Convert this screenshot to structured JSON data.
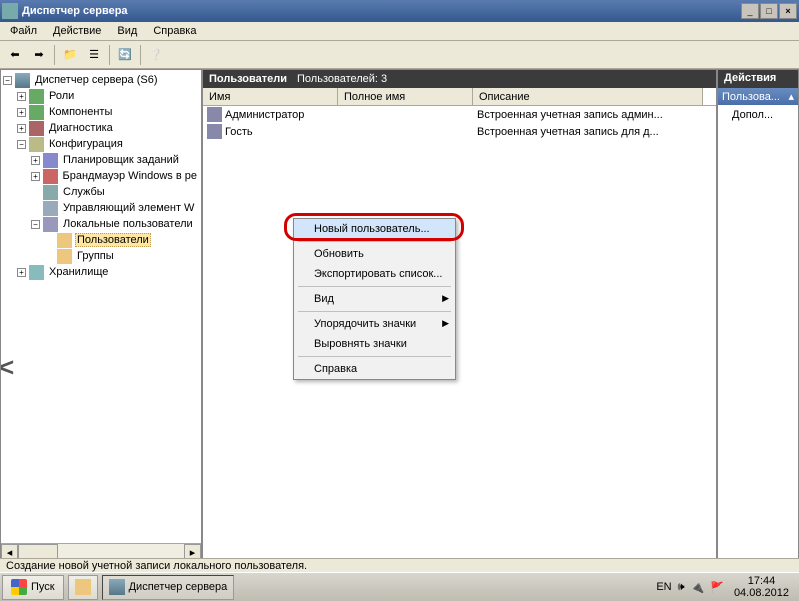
{
  "window": {
    "title": "Диспетчер сервера",
    "btn_min": "_",
    "btn_max": "□",
    "btn_close": "×"
  },
  "menu": {
    "file": "Файл",
    "action": "Действие",
    "view": "Вид",
    "help": "Справка"
  },
  "tree": {
    "root": "Диспетчер сервера (S6)",
    "roles": "Роли",
    "components": "Компоненты",
    "diagnostics": "Диагностика",
    "configuration": "Конфигурация",
    "taskscheduler": "Планировщик заданий",
    "firewall": "Брандмауэр Windows в ре",
    "services": "Службы",
    "wmi": "Управляющий элемент W",
    "localusers": "Локальные пользователи",
    "users": "Пользователи",
    "groups": "Группы",
    "storage": "Хранилище"
  },
  "list": {
    "header_title": "Пользователи",
    "header_count_label": "Пользователей: 3",
    "columns": {
      "name": "Имя",
      "fullname": "Полное имя",
      "description": "Описание"
    },
    "rows": [
      {
        "name": "Администратор",
        "fullname": "",
        "description": "Встроенная учетная запись админ..."
      },
      {
        "name": "Гость",
        "fullname": "",
        "description": "Встроенная учетная запись для д..."
      }
    ]
  },
  "context": {
    "new_user": "Новый пользователь...",
    "refresh": "Обновить",
    "export": "Экспортировать список...",
    "view": "Вид",
    "arrange": "Упорядочить значки",
    "align": "Выровнять значки",
    "help": "Справка"
  },
  "actions": {
    "header": "Действия",
    "section": "Пользова...",
    "more": "Допол..."
  },
  "status": "Создание новой учетной записи локального пользователя.",
  "taskbar": {
    "start": "Пуск",
    "app": "Диспетчер сервера",
    "lang": "EN",
    "time": "17:44",
    "date": "04.08.2012"
  }
}
